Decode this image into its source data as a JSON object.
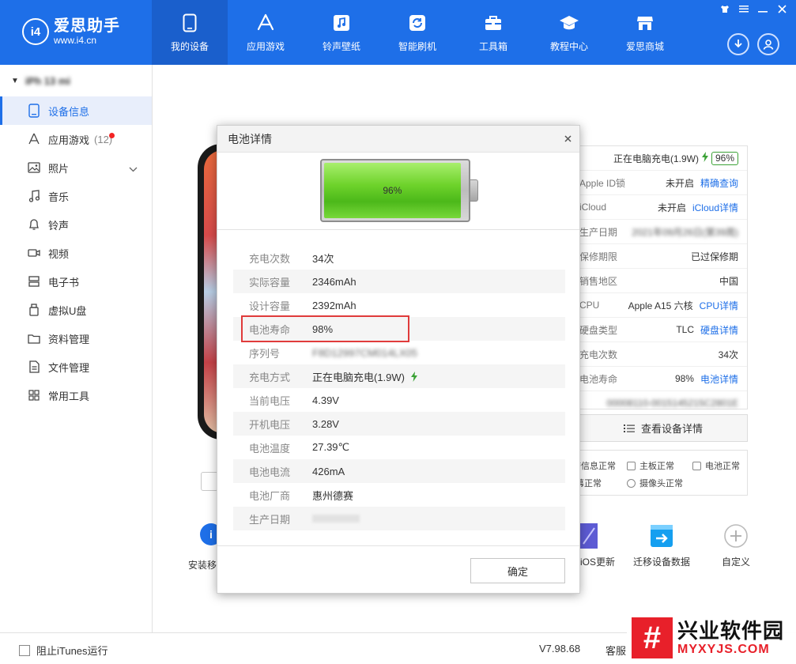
{
  "app": {
    "logo_badge": "i4",
    "name": "爱思助手",
    "url": "www.i4.cn"
  },
  "nav": [
    {
      "label": "我的设备",
      "icon": "phone-icon",
      "active": true
    },
    {
      "label": "应用游戏",
      "icon": "app-store-icon"
    },
    {
      "label": "铃声壁纸",
      "icon": "music-note-icon"
    },
    {
      "label": "智能刷机",
      "icon": "refresh-icon"
    },
    {
      "label": "工具箱",
      "icon": "toolbox-icon"
    },
    {
      "label": "教程中心",
      "icon": "graduation-cap-icon"
    },
    {
      "label": "爱思商城",
      "icon": "store-icon"
    }
  ],
  "window_controls": [
    "shirt-icon",
    "menu-icon",
    "minimize-icon",
    "close-icon"
  ],
  "sidebar": {
    "device_name": "iPh 13 mi",
    "items": [
      {
        "label": "设备信息",
        "icon": "device-info-icon",
        "active": true
      },
      {
        "label": "应用游戏",
        "count": "(12)",
        "icon": "app-icon",
        "badge": true
      },
      {
        "label": "照片",
        "icon": "photo-icon",
        "expandable": true
      },
      {
        "label": "音乐",
        "icon": "music-icon"
      },
      {
        "label": "铃声",
        "icon": "bell-icon"
      },
      {
        "label": "视频",
        "icon": "video-icon"
      },
      {
        "label": "电子书",
        "icon": "book-icon"
      },
      {
        "label": "虚拟U盘",
        "icon": "usb-icon"
      },
      {
        "label": "资料管理",
        "icon": "folder-icon"
      },
      {
        "label": "文件管理",
        "icon": "file-icon"
      },
      {
        "label": "常用工具",
        "icon": "grid-icon"
      }
    ]
  },
  "footer": {
    "itunes_label": "阻止iTunes运行",
    "version": "V7.98.68",
    "service": "客服"
  },
  "device_info": {
    "charging_text": "正在电脑充电(1.9W)",
    "battery_badge": "96%",
    "rows": [
      {
        "key": "Apple ID锁",
        "value": "未开启",
        "link": "精确查询"
      },
      {
        "key": "iCloud",
        "value": "未开启",
        "link": "iCloud详情"
      },
      {
        "key": "生产日期",
        "value": "2021年09月26日(第39周)",
        "blurred": true
      },
      {
        "key": "保修期限",
        "value": "已过保修期"
      },
      {
        "key": "销售地区",
        "value": "中国"
      },
      {
        "key": "CPU",
        "value": "Apple A15 六核",
        "link": "CPU详情"
      },
      {
        "key": "硬盘类型",
        "value": "TLC",
        "link": "硬盘详情"
      },
      {
        "key": "充电次数",
        "value": "34次"
      },
      {
        "key": "电池寿命",
        "value": "98%",
        "link": "电池详情"
      },
      {
        "key": "",
        "value": "00008110-0015145215C2801E",
        "blurred": true
      }
    ],
    "view_detail": "查看设备详情",
    "status": [
      {
        "label": "基带信息正常"
      },
      {
        "label": "主板正常"
      },
      {
        "label": "电池正常"
      },
      {
        "label": "摄像头正常"
      },
      {
        "label": "屏幕正常"
      }
    ]
  },
  "tools": [
    {
      "label": "安装移动端",
      "icon": "install-app-icon"
    },
    {
      "label": "iOS更新",
      "icon": "ios-update-icon"
    },
    {
      "label": "迁移设备数据",
      "icon": "migrate-icon"
    },
    {
      "label": "自定义",
      "icon": "plus-icon"
    }
  ],
  "battery_modal": {
    "title": "电池详情",
    "level_text": "96%",
    "level": 0.96,
    "rows": [
      {
        "key": "充电次数",
        "value": "34次"
      },
      {
        "key": "实际容量",
        "value": "2346mAh"
      },
      {
        "key": "设计容量",
        "value": "2392mAh"
      },
      {
        "key": "电池寿命",
        "value": "98%"
      },
      {
        "key": "序列号",
        "value": "F8D12997CM014LX05",
        "blurred": true
      },
      {
        "key": "充电方式",
        "value": "正在电脑充电(1.9W)",
        "bolt": true
      },
      {
        "key": "当前电压",
        "value": "4.39V"
      },
      {
        "key": "开机电压",
        "value": "3.28V"
      },
      {
        "key": "电池温度",
        "value": "27.39℃"
      },
      {
        "key": "电池电流",
        "value": "426mA"
      },
      {
        "key": "电池厂商",
        "value": "惠州德赛"
      },
      {
        "key": "生产日期",
        "value": "",
        "blurbar": true
      }
    ],
    "ok_label": "确定"
  },
  "watermark": {
    "logo": "#",
    "name": "兴业软件园",
    "url": "MYXYJS.COM"
  },
  "colors": {
    "header": "#1e6fe8",
    "header_active": "#1a5fcc",
    "accent": "#1e6fe8",
    "highlight": "#e03b3b",
    "battery_green": "#6ed32b",
    "watermark_red": "#e8202a"
  }
}
